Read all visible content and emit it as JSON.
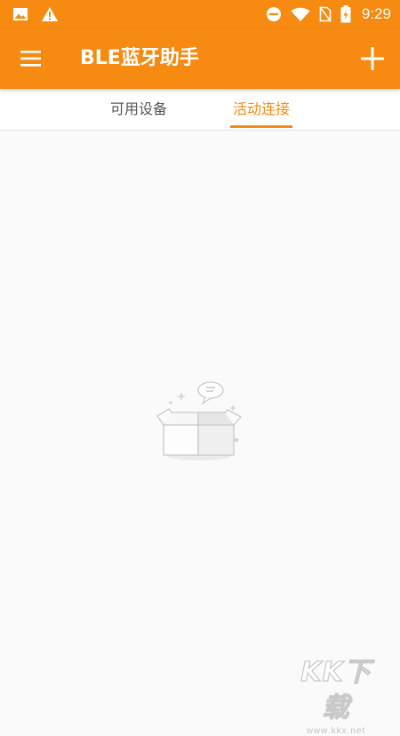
{
  "status_bar": {
    "time": "9:29",
    "icons": [
      "image-icon",
      "warning-icon",
      "dnd-icon",
      "wifi-icon",
      "no-sim-icon",
      "battery-icon"
    ]
  },
  "app_bar": {
    "title": "BLE蓝牙助手",
    "menu_icon": "menu-icon",
    "add_icon": "plus-icon"
  },
  "tabs": [
    {
      "label": "可用设备",
      "active": false
    },
    {
      "label": "活动连接",
      "active": true
    }
  ],
  "content": {
    "empty_state_icon": "empty-box-icon"
  },
  "watermark": {
    "logo": "KK下载",
    "url": "www.kkx.net"
  },
  "colors": {
    "primary": "#f78a10",
    "tab_inactive": "#555555",
    "background": "#fafafa"
  }
}
